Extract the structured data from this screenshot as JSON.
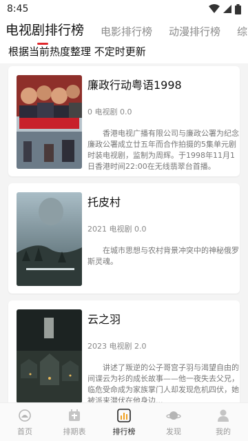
{
  "status": {
    "time": "8:45"
  },
  "tabs": [
    {
      "label": "电视剧排行榜",
      "active": true
    },
    {
      "label": "电影排行榜",
      "active": false
    },
    {
      "label": "动漫排行榜",
      "active": false
    },
    {
      "label": "综艺",
      "active": false
    }
  ],
  "subtitle": "根据当前热度整理  不定时更新",
  "items": [
    {
      "title": "廉政行动粤语1998",
      "meta": "0 电视剧 0.0",
      "desc": "香港电视广播有限公司与廉政公署为纪念廉政公署成立廿五年而合作拍摄的5集单元剧时装电视剧，监制为周辉。于1998年11月1日香港时间22:00在无线翡翠台首播。"
    },
    {
      "title": "托皮村",
      "meta": "2021 电视剧 0.0",
      "desc": "在城市思想与农村背景冲突中的神秘俄罗斯灵魂。"
    },
    {
      "title": "云之羽",
      "meta": "2023 电视剧 2.0",
      "desc": "讲述了叛逆的公子哥宫子羽与渴望自由的间谍云为衫的成长故事——他一夜失去父兄，临危受命成为家族掌门人却发现危机四伏，她被派来潜伏在他身边..."
    }
  ],
  "nav": [
    {
      "label": "首页",
      "icon": "home-icon",
      "active": false
    },
    {
      "label": "排期表",
      "icon": "calendar-icon",
      "active": false
    },
    {
      "label": "排行榜",
      "icon": "chart-icon",
      "active": true
    },
    {
      "label": "发现",
      "icon": "planet-icon",
      "active": false
    },
    {
      "label": "我的",
      "icon": "user-icon",
      "active": false
    }
  ],
  "colors": {
    "accent": "#e0282c",
    "active_text": "#222222",
    "inactive_text": "#9a9a9a"
  }
}
